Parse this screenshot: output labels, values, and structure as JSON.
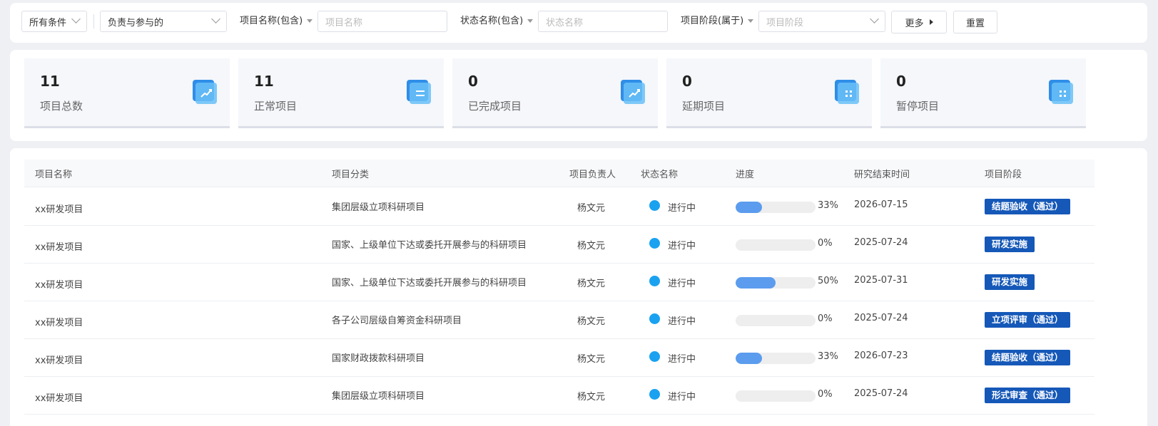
{
  "filters": {
    "condition_select": "所有条件",
    "scope_select": "负责与参与的",
    "project_name_label": "项目名称(包含)",
    "project_name_placeholder": "项目名称",
    "status_name_label": "状态名称(包含)",
    "status_name_placeholder": "状态名称",
    "stage_label": "项目阶段(属于)",
    "stage_placeholder": "项目阶段",
    "more_button": "更多",
    "reset_button": "重置"
  },
  "stats": [
    {
      "value": "11",
      "label": "项目总数",
      "icon": "chart-up-icon"
    },
    {
      "value": "11",
      "label": "正常项目",
      "icon": "document-list-icon"
    },
    {
      "value": "0",
      "label": "已完成项目",
      "icon": "chart-up-icon"
    },
    {
      "value": "0",
      "label": "延期项目",
      "icon": "grid-apps-icon"
    },
    {
      "value": "0",
      "label": "暂停项目",
      "icon": "grid-apps-icon"
    }
  ],
  "table": {
    "headers": [
      "项目名称",
      "项目分类",
      "项目负责人",
      "状态名称",
      "进度",
      "研究结束时间",
      "项目阶段"
    ],
    "rows": [
      {
        "name": "xx研发项目",
        "category": "集团层级立项科研项目",
        "owner": "杨文元",
        "status": "进行中",
        "progress": 33,
        "progress_text": "33%",
        "end_date": "2026-07-15",
        "stage": "结题验收（通过）"
      },
      {
        "name": "xx研发项目",
        "category": "国家、上级单位下达或委托开展参与的科研项目",
        "owner": "杨文元",
        "status": "进行中",
        "progress": 0,
        "progress_text": "0%",
        "end_date": "2025-07-24",
        "stage": "研发实施"
      },
      {
        "name": "xx研发项目",
        "category": "国家、上级单位下达或委托开展参与的科研项目",
        "owner": "杨文元",
        "status": "进行中",
        "progress": 50,
        "progress_text": "50%",
        "end_date": "2025-07-31",
        "stage": "研发实施"
      },
      {
        "name": "xx研发项目",
        "category": "各子公司层级自筹资金科研项目",
        "owner": "杨文元",
        "status": "进行中",
        "progress": 0,
        "progress_text": "0%",
        "end_date": "2025-07-24",
        "stage": "立项评审（通过）"
      },
      {
        "name": "xx研发项目",
        "category": "国家财政拨款科研项目",
        "owner": "杨文元",
        "status": "进行中",
        "progress": 33,
        "progress_text": "33%",
        "end_date": "2026-07-23",
        "stage": "结题验收（通过）"
      },
      {
        "name": "xx研发项目",
        "category": "集团层级立项科研项目",
        "owner": "杨文元",
        "status": "进行中",
        "progress": 0,
        "progress_text": "0%",
        "end_date": "2025-07-24",
        "stage": "形式审查（通过）"
      }
    ]
  }
}
